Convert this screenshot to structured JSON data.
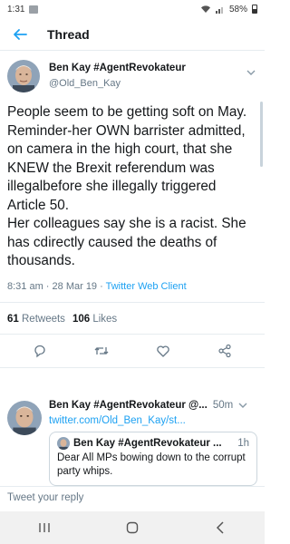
{
  "status_bar": {
    "time": "1:31",
    "battery": "58%"
  },
  "header": {
    "title": "Thread"
  },
  "main_tweet": {
    "display_name": "Ben Kay #AgentRevokateur",
    "handle": "@Old_Ben_Kay",
    "text": "People seem to be getting soft on May.\nReminder-her OWN barrister admitted, on camera in the high court, that she KNEW the Brexit referendum was illegalbefore she illegally triggered Article 50.\nHer colleagues say she is a racist. She has cdirectly caused the deaths of thousands.",
    "timestamp": "8:31 am · 28 Mar 19 · ",
    "client": "Twitter Web Client",
    "retweets_count": "61",
    "retweets_label": "Retweets",
    "likes_count": "106",
    "likes_label": "Likes"
  },
  "reply_tweet": {
    "display_name": "Ben Kay #AgentRevokateur @...",
    "time": "50m",
    "link": "twitter.com/Old_Ben_Kay/st...",
    "quote": {
      "display_name": "Ben Kay #AgentRevokateur ...",
      "time": "1h",
      "text": "Dear All MPs bowing down to the corrupt party whips."
    }
  },
  "reply_bar": {
    "placeholder": "Tweet your reply"
  },
  "icons": {
    "back": "back-arrow-icon",
    "caret": "chevron-down-icon",
    "reply": "reply-icon",
    "retweet": "retweet-icon",
    "like": "heart-icon",
    "share": "share-icon"
  },
  "colors": {
    "accent": "#1da1f2",
    "text": "#14171a",
    "muted": "#657786"
  }
}
